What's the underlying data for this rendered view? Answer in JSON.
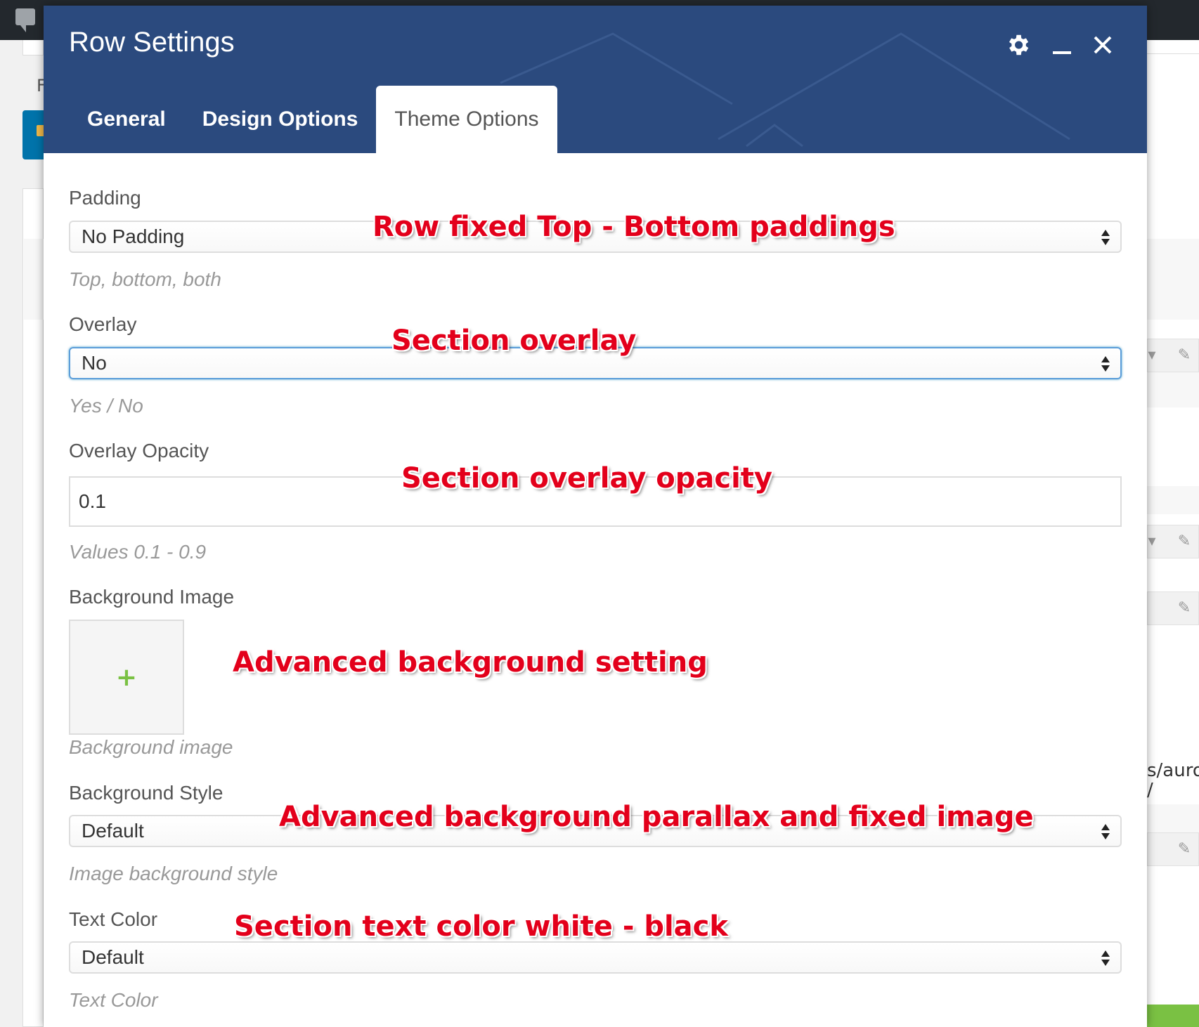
{
  "modal": {
    "title": "Row Settings",
    "tabs": [
      {
        "label": "General",
        "active": false
      },
      {
        "label": "Design Options",
        "active": false
      },
      {
        "label": "Theme Options",
        "active": true
      }
    ],
    "header_color": "#2b4a7e"
  },
  "fields": {
    "padding": {
      "label": "Padding",
      "value": "No Padding",
      "help": "Top, bottom, both"
    },
    "overlay": {
      "label": "Overlay",
      "value": "No",
      "help": "Yes / No"
    },
    "overlay_opacity": {
      "label": "Overlay Opacity",
      "value": "0.1",
      "help": "Values 0.1 - 0.9"
    },
    "background_image": {
      "label": "Background Image",
      "button": "+",
      "help": "Background image"
    },
    "background_style": {
      "label": "Background Style",
      "value": "Default",
      "help": "Image background style"
    },
    "text_color": {
      "label": "Text Color",
      "value": "Default",
      "help": "Text Color"
    }
  },
  "annotations": {
    "padding": "Row fixed Top - Bottom paddings",
    "overlay": "Section overlay",
    "opacity": "Section overlay opacity",
    "background": "Advanced background setting",
    "parallax": "Advanced background parallax and fixed image",
    "text_color": "Section text color white - black",
    "color": "#e3001b"
  },
  "background": {
    "left_letter": "F",
    "path_text": "s/auro",
    "path_text2": "/"
  }
}
